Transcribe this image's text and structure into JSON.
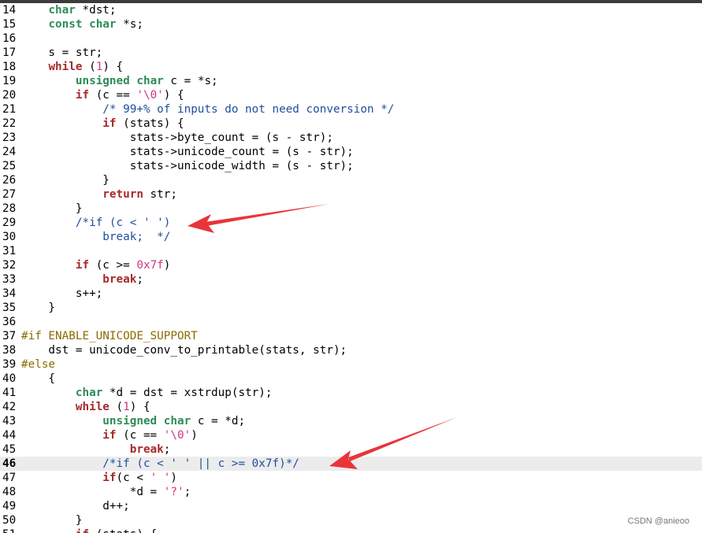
{
  "lines": [
    {
      "n": "14",
      "segs": [
        {
          "t": "    "
        },
        {
          "t": "char",
          "c": "ty"
        },
        {
          "t": " *dst;"
        }
      ]
    },
    {
      "n": "15",
      "segs": [
        {
          "t": "    "
        },
        {
          "t": "const",
          "c": "ty"
        },
        {
          "t": " "
        },
        {
          "t": "char",
          "c": "ty"
        },
        {
          "t": " *s;"
        }
      ]
    },
    {
      "n": "16",
      "segs": []
    },
    {
      "n": "17",
      "segs": [
        {
          "t": "    s = str;"
        }
      ]
    },
    {
      "n": "18",
      "segs": [
        {
          "t": "    "
        },
        {
          "t": "while",
          "c": "kw"
        },
        {
          "t": " ("
        },
        {
          "t": "1",
          "c": "lit"
        },
        {
          "t": ") {"
        }
      ]
    },
    {
      "n": "19",
      "segs": [
        {
          "t": "        "
        },
        {
          "t": "unsigned",
          "c": "ty"
        },
        {
          "t": " "
        },
        {
          "t": "char",
          "c": "ty"
        },
        {
          "t": " c = *s;"
        }
      ]
    },
    {
      "n": "20",
      "segs": [
        {
          "t": "        "
        },
        {
          "t": "if",
          "c": "kw"
        },
        {
          "t": " (c == "
        },
        {
          "t": "'\\0'",
          "c": "lit"
        },
        {
          "t": ") {"
        }
      ]
    },
    {
      "n": "21",
      "segs": [
        {
          "t": "            "
        },
        {
          "t": "/* 99+% of inputs do not need conversion */",
          "c": "cm"
        }
      ]
    },
    {
      "n": "22",
      "segs": [
        {
          "t": "            "
        },
        {
          "t": "if",
          "c": "kw"
        },
        {
          "t": " (stats) {"
        }
      ]
    },
    {
      "n": "23",
      "segs": [
        {
          "t": "                stats->byte_count = (s - str);"
        }
      ]
    },
    {
      "n": "24",
      "segs": [
        {
          "t": "                stats->unicode_count = (s - str);"
        }
      ]
    },
    {
      "n": "25",
      "segs": [
        {
          "t": "                stats->unicode_width = (s - str);"
        }
      ]
    },
    {
      "n": "26",
      "segs": [
        {
          "t": "            }"
        }
      ]
    },
    {
      "n": "27",
      "segs": [
        {
          "t": "            "
        },
        {
          "t": "return",
          "c": "kw"
        },
        {
          "t": " str;"
        }
      ]
    },
    {
      "n": "28",
      "segs": [
        {
          "t": "        }"
        }
      ]
    },
    {
      "n": "29",
      "segs": [
        {
          "t": "        "
        },
        {
          "t": "/*if (c < ' ')",
          "c": "cm"
        }
      ]
    },
    {
      "n": "30",
      "segs": [
        {
          "t": "            "
        },
        {
          "t": "break;  */",
          "c": "cm"
        }
      ]
    },
    {
      "n": "31",
      "segs": []
    },
    {
      "n": "32",
      "segs": [
        {
          "t": "        "
        },
        {
          "t": "if",
          "c": "kw"
        },
        {
          "t": " (c >= "
        },
        {
          "t": "0x7f",
          "c": "lit"
        },
        {
          "t": ")"
        }
      ]
    },
    {
      "n": "33",
      "segs": [
        {
          "t": "            "
        },
        {
          "t": "break",
          "c": "kw"
        },
        {
          "t": ";"
        }
      ]
    },
    {
      "n": "34",
      "segs": [
        {
          "t": "        s++;"
        }
      ]
    },
    {
      "n": "35",
      "segs": [
        {
          "t": "    }"
        }
      ]
    },
    {
      "n": "36",
      "segs": []
    },
    {
      "n": "37",
      "segs": [
        {
          "t": "#if ENABLE_UNICODE_SUPPORT",
          "c": "pp"
        }
      ]
    },
    {
      "n": "38",
      "segs": [
        {
          "t": "    dst = unicode_conv_to_printable(stats, str);"
        }
      ]
    },
    {
      "n": "39",
      "segs": [
        {
          "t": "#else",
          "c": "pp"
        }
      ]
    },
    {
      "n": "40",
      "segs": [
        {
          "t": "    {"
        }
      ]
    },
    {
      "n": "41",
      "segs": [
        {
          "t": "        "
        },
        {
          "t": "char",
          "c": "ty"
        },
        {
          "t": " *d = dst = xstrdup(str);"
        }
      ]
    },
    {
      "n": "42",
      "segs": [
        {
          "t": "        "
        },
        {
          "t": "while",
          "c": "kw"
        },
        {
          "t": " ("
        },
        {
          "t": "1",
          "c": "lit"
        },
        {
          "t": ") {"
        }
      ]
    },
    {
      "n": "43",
      "segs": [
        {
          "t": "            "
        },
        {
          "t": "unsigned",
          "c": "ty"
        },
        {
          "t": " "
        },
        {
          "t": "char",
          "c": "ty"
        },
        {
          "t": " c = *d;"
        }
      ]
    },
    {
      "n": "44",
      "segs": [
        {
          "t": "            "
        },
        {
          "t": "if",
          "c": "kw"
        },
        {
          "t": " (c == "
        },
        {
          "t": "'\\0'",
          "c": "lit"
        },
        {
          "t": ")"
        }
      ]
    },
    {
      "n": "45",
      "segs": [
        {
          "t": "                "
        },
        {
          "t": "break",
          "c": "kw"
        },
        {
          "t": ";"
        }
      ]
    },
    {
      "n": "46",
      "current": true,
      "segs": [
        {
          "t": "            "
        },
        {
          "t": "/*if (c < ' ' || c >= 0x7f)*/",
          "c": "cm"
        }
      ]
    },
    {
      "n": "47",
      "segs": [
        {
          "t": "            "
        },
        {
          "t": "if",
          "c": "kw"
        },
        {
          "t": "(c < "
        },
        {
          "t": "' '",
          "c": "lit"
        },
        {
          "t": ")"
        }
      ]
    },
    {
      "n": "48",
      "segs": [
        {
          "t": "                *d = "
        },
        {
          "t": "'?'",
          "c": "lit"
        },
        {
          "t": ";"
        }
      ]
    },
    {
      "n": "49",
      "segs": [
        {
          "t": "            d++;"
        }
      ]
    },
    {
      "n": "50",
      "segs": [
        {
          "t": "        }"
        }
      ]
    },
    {
      "n": "51",
      "segs": [
        {
          "t": "        "
        },
        {
          "t": "if",
          "c": "kw"
        },
        {
          "t": " (stats) {"
        }
      ]
    }
  ],
  "annotations": {
    "arrow_color": "#e8353a"
  },
  "watermark": {
    "text": "CSDN @anieoo"
  }
}
